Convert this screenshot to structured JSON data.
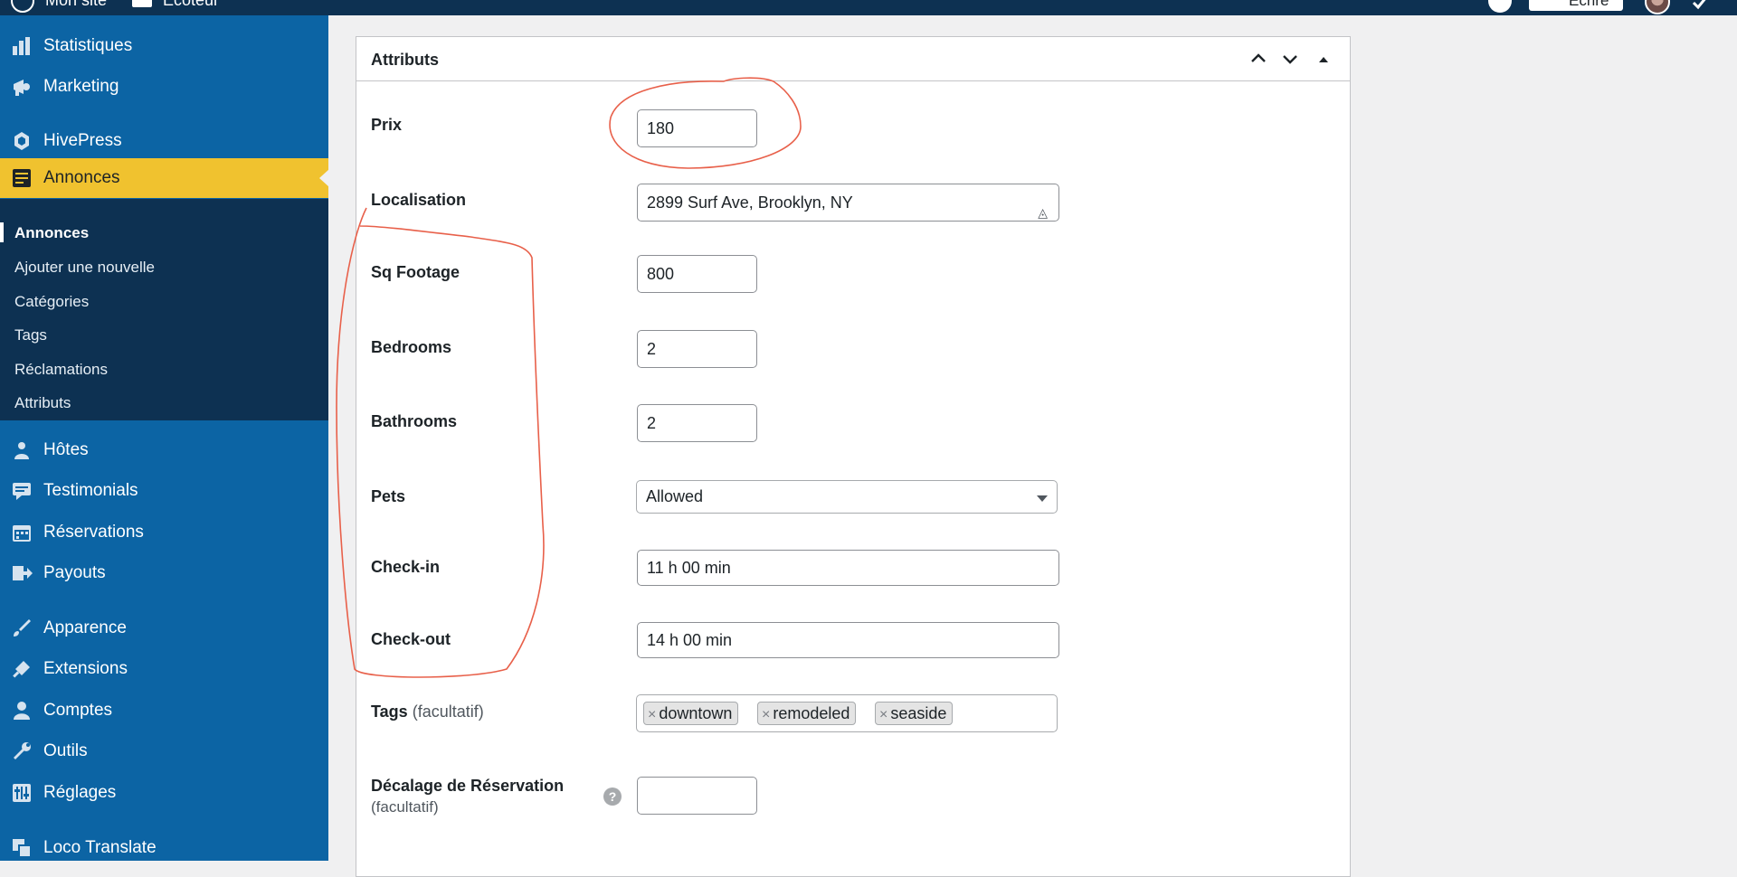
{
  "adminbar": {
    "site_name": "Mon site",
    "new_label": "Ecoteur",
    "write_label": "Écrire"
  },
  "sidebar": {
    "items": [
      {
        "label": "Statistiques",
        "icon": "bar-chart-icon"
      },
      {
        "label": "Marketing",
        "icon": "megaphone-icon"
      },
      {
        "label": "HivePress",
        "icon": "hivepress-icon"
      },
      {
        "label": "Annonces",
        "icon": "listing-icon",
        "active": true
      },
      {
        "label": "Hôtes",
        "icon": "host-icon"
      },
      {
        "label": "Testimonials",
        "icon": "comment-icon"
      },
      {
        "label": "Réservations",
        "icon": "calendar-icon"
      },
      {
        "label": "Payouts",
        "icon": "payout-icon"
      },
      {
        "label": "Apparence",
        "icon": "brush-icon"
      },
      {
        "label": "Extensions",
        "icon": "plugin-icon"
      },
      {
        "label": "Comptes",
        "icon": "user-icon"
      },
      {
        "label": "Outils",
        "icon": "wrench-icon"
      },
      {
        "label": "Réglages",
        "icon": "settings-icon"
      },
      {
        "label": "Loco Translate",
        "icon": "translate-icon"
      }
    ],
    "submenu": [
      "Annonces",
      "Ajouter une nouvelle",
      "Catégories",
      "Tags",
      "Réclamations",
      "Attributs"
    ]
  },
  "panel": {
    "title": "Attributs",
    "fields": {
      "prix": {
        "label": "Prix",
        "value": "180"
      },
      "localisation": {
        "label": "Localisation",
        "value": "2899 Surf Ave, Brooklyn, NY"
      },
      "sq_footage": {
        "label": "Sq Footage",
        "value": "800"
      },
      "bedrooms": {
        "label": "Bedrooms",
        "value": "2"
      },
      "bathrooms": {
        "label": "Bathrooms",
        "value": "2"
      },
      "pets": {
        "label": "Pets",
        "value": "Allowed"
      },
      "checkin": {
        "label": "Check-in",
        "value": "11 h 00 min"
      },
      "checkout": {
        "label": "Check-out",
        "value": "14 h 00 min"
      },
      "tags": {
        "label": "Tags",
        "optional": "(facultatif)",
        "values": [
          "downtown",
          "remodeled",
          "seaside"
        ]
      },
      "decalage": {
        "label": "Décalage de Réservation",
        "optional": "(facultatif)",
        "value": ""
      }
    }
  },
  "colors": {
    "sidebar": "#0c64a4",
    "submenu": "#0d3152",
    "active": "#f0c22f",
    "annotation": "#e8604a"
  }
}
